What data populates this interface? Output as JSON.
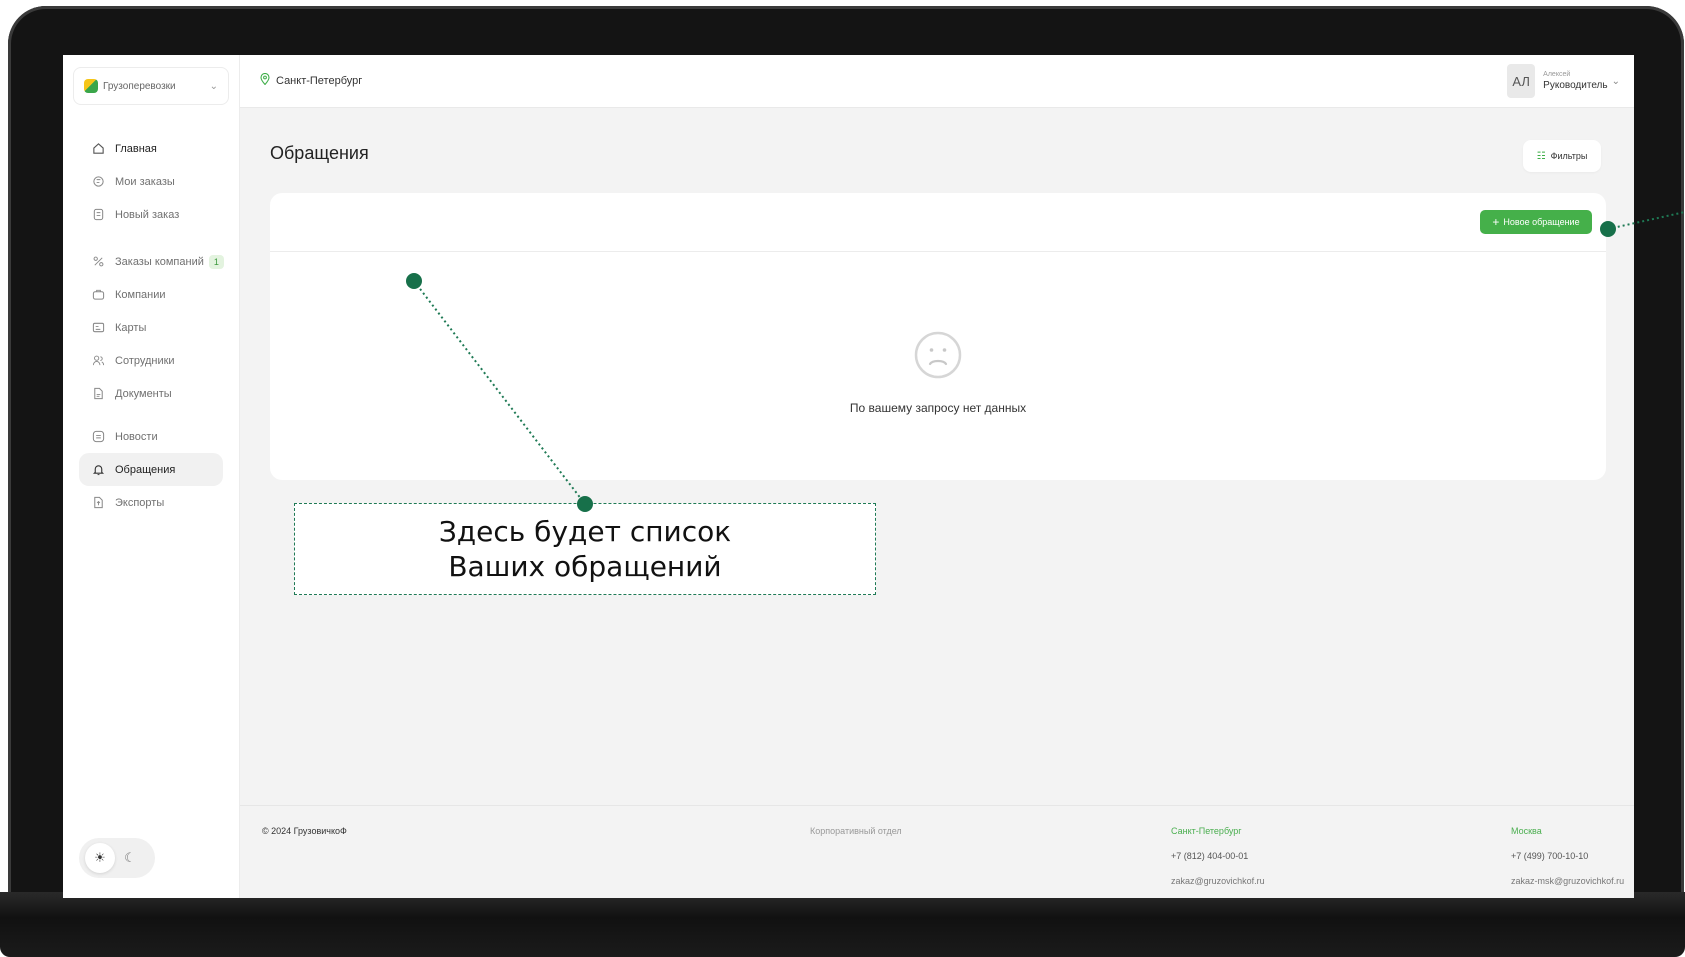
{
  "sidebar": {
    "company": "Грузоперевозки",
    "items": [
      {
        "label": "Главная"
      },
      {
        "label": "Мои заказы"
      },
      {
        "label": "Новый заказ"
      },
      {
        "label": "Заказы компаний",
        "badge": "1"
      },
      {
        "label": "Компании"
      },
      {
        "label": "Карты"
      },
      {
        "label": "Сотрудники"
      },
      {
        "label": "Документы"
      },
      {
        "label": "Новости"
      },
      {
        "label": "Обращения"
      },
      {
        "label": "Экспорты"
      }
    ]
  },
  "header": {
    "city": "Санкт-Петербург",
    "user": {
      "initials": "АЛ",
      "name": "Алексей",
      "role": "Руководитель"
    }
  },
  "main": {
    "title": "Обращения",
    "filters_label": "Фильтры",
    "new_button": "Новое обращение",
    "empty_text": "По вашему запросу нет данных"
  },
  "annotation": {
    "line1": "Здесь будет список",
    "line2": "Ваших обращений"
  },
  "footer": {
    "copyright": "© 2024 ГрузовичкоФ",
    "corporate": "Корпоративный отдел",
    "spb": {
      "city": "Санкт-Петербург",
      "phone": "+7 (812) 404-00-01",
      "email": "zakaz@gruzovichkof.ru"
    },
    "msk": {
      "city": "Москва",
      "phone": "+7 (499) 700-10-10",
      "email": "zakaz-msk@gruzovichkof.ru"
    }
  },
  "colors": {
    "accent": "#45b04a",
    "annotation": "#1f7a55"
  }
}
